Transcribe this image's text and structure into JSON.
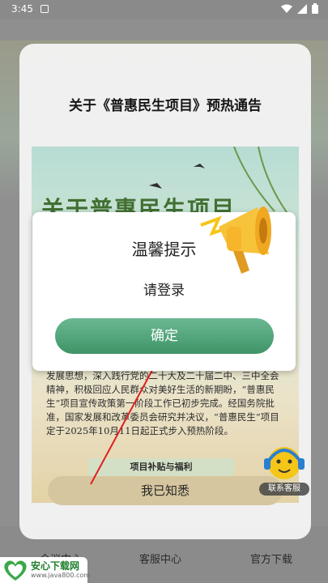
{
  "status_bar": {
    "time": "3:45"
  },
  "background": {
    "tabs": [
      "会议中心",
      "客服中心",
      "官方下载"
    ]
  },
  "announcement": {
    "title": "关于《普惠民生项目》预热通告",
    "poster_heading": "关于普惠民生项目",
    "poster_text": "发展思想，深入践行党的二十大及二十届二中、三中全会精神，积极回应人民群众对美好生活的新期盼，“普惠民生”项目宣传政策第一阶段工作已初步完成。经国务院批准，国家发展和改革委员会研究并决议，“普惠民生”项目定于2025年10月11日起正式步入预热阶段。",
    "poster_tag": "项目补贴与福利",
    "ack_button": "我已知悉"
  },
  "dialog": {
    "title": "温馨提示",
    "message": "请登录",
    "confirm_button": "确定"
  },
  "customer_service": {
    "label": "联系客服"
  },
  "watermark": {
    "brand": "安心下载网",
    "url": "www.java800.com"
  },
  "colors": {
    "confirm_green": "#4fa376",
    "ack_tan": "#d9c9a0",
    "overlay_gray": "#8e8e8e"
  }
}
